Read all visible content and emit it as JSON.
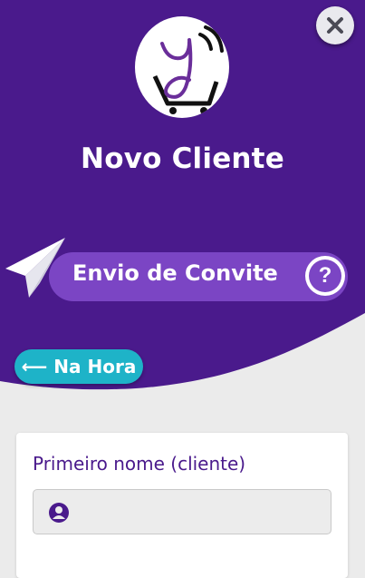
{
  "header": {
    "title": "Novo Cliente",
    "close_icon": "close-icon",
    "logo_icon": "shopping-cart-logo-icon"
  },
  "invite": {
    "label": "Envio de Convite",
    "plane_icon": "paper-plane-icon",
    "help_icon": "question-circle-icon",
    "help_glyph": "?"
  },
  "na_hora": {
    "label": "⟵ Na Hora",
    "arrow_icon": "arrow-left-icon"
  },
  "form": {
    "first_name": {
      "label": "Primeiro nome (cliente)",
      "value": "",
      "placeholder": "",
      "icon": "user-circle-icon"
    }
  },
  "colors": {
    "brand_purple": "#4a1a8c",
    "pill_purple": "#7b45c4",
    "accent_teal": "#1eb3c8",
    "background": "#ebebeb"
  }
}
